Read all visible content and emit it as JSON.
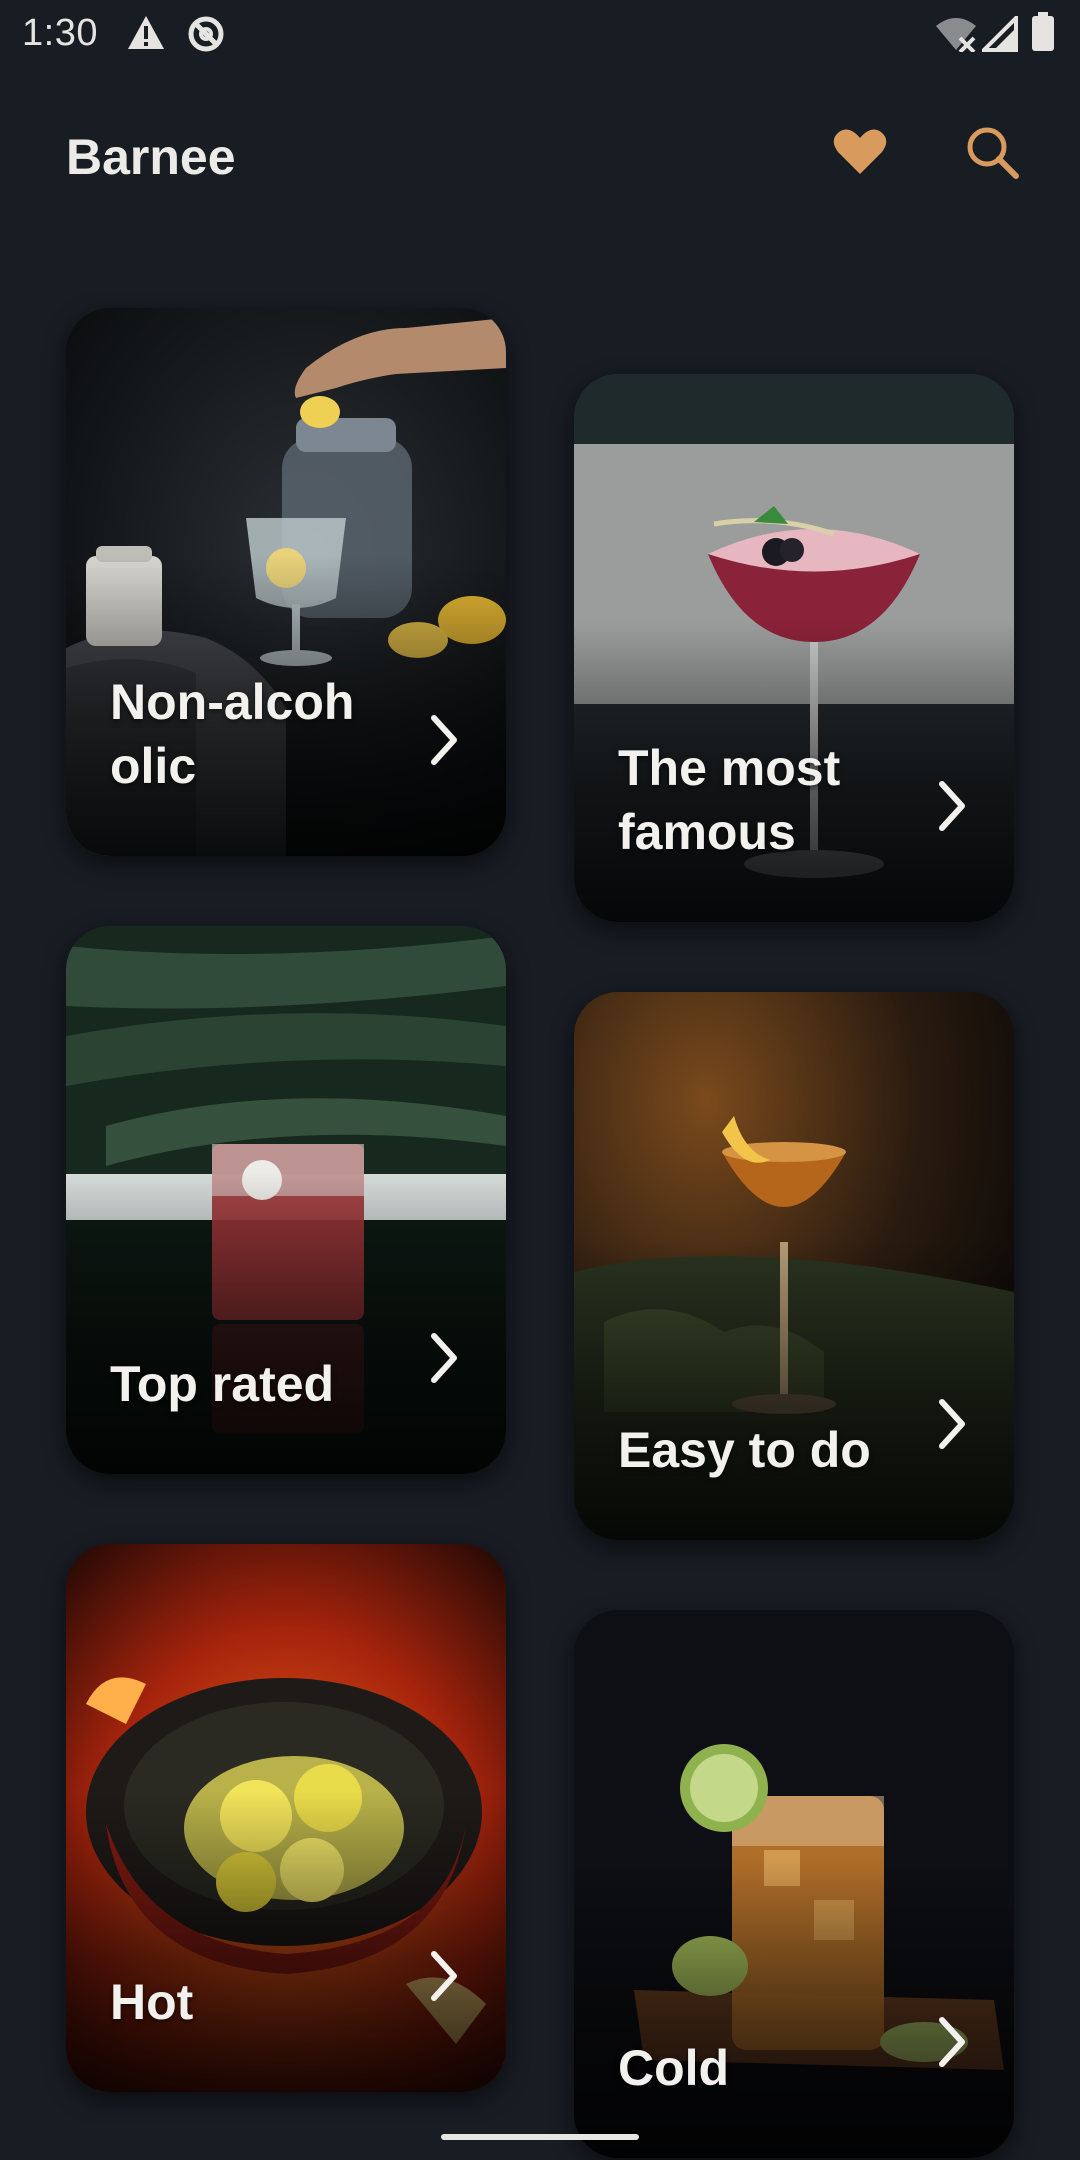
{
  "status_bar": {
    "time": "1:30",
    "left_icons": [
      "warning-icon",
      "sync-disabled-icon"
    ],
    "right_icons": [
      "wifi-off-icon",
      "signal-icon",
      "battery-icon"
    ]
  },
  "app_bar": {
    "title": "Barnee",
    "actions": [
      {
        "name": "favorites",
        "icon": "heart-icon"
      },
      {
        "name": "search",
        "icon": "search-icon"
      }
    ]
  },
  "categories": [
    {
      "label": "Non-alcoh olic",
      "photo": "lemon water glass with hand squeezing lemon"
    },
    {
      "label": "The most famous",
      "photo": "pink cocktail coupe with blackberry garnish"
    },
    {
      "label": "Top rated",
      "photo": "red cocktail highball with palm leaves"
    },
    {
      "label": "Easy to do",
      "photo": "amber cocktail with lemon twist"
    },
    {
      "label": "Hot",
      "photo": "lemon punch pot over fire"
    },
    {
      "label": "Cold",
      "photo": "iced tea glass with lime"
    }
  ],
  "colors": {
    "background": "#181c23",
    "accent": "#d99a5e",
    "title_text": "#ecebe7",
    "card_text": "#f3f1ee"
  },
  "system": {
    "home_indicator": "home-indicator"
  }
}
